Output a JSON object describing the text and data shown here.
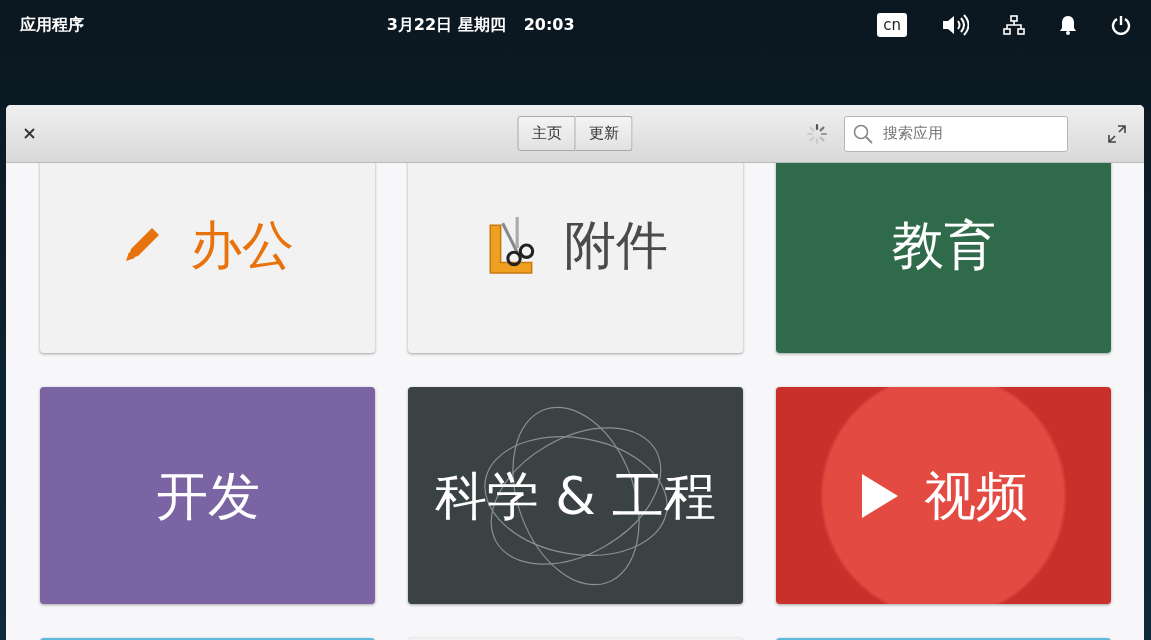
{
  "top_bar": {
    "app_menu": "应用程序",
    "date": "3月22日 星期四",
    "time": "20:03",
    "keyboard_layout": "cn"
  },
  "window": {
    "tabs": [
      {
        "label": "主页",
        "selected": false
      },
      {
        "label": "更新",
        "selected": false
      }
    ],
    "search": {
      "placeholder": "搜索应用"
    }
  },
  "categories": [
    {
      "label": "办公",
      "kind": "pencil",
      "color": "#f2f2f2"
    },
    {
      "label": "附件",
      "kind": "tools",
      "color": "#f2f2f2"
    },
    {
      "label": "教育",
      "kind": "plain",
      "color": "#2f6a4b"
    },
    {
      "label": "开发",
      "kind": "plain",
      "color": "#7a64a3"
    },
    {
      "label": "科学 & 工程",
      "kind": "atom",
      "color": "#3a4244"
    },
    {
      "label": "视频",
      "kind": "play",
      "color": "#c9302c"
    },
    {
      "kind": "blank",
      "color": "#5bb8de"
    },
    {
      "kind": "blank",
      "color": "#f2f2f2"
    },
    {
      "kind": "blank",
      "color": "#5bb8de"
    }
  ]
}
